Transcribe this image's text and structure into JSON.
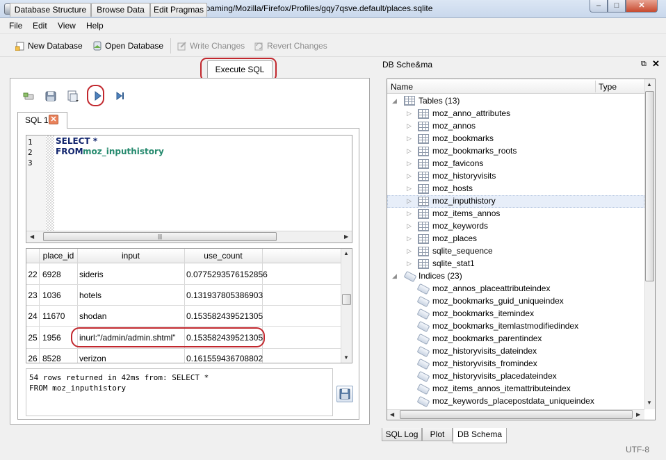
{
  "window": {
    "title": "DB Browser for SQLite - C:/Users/███/AppData/Roaming/Mozilla/Firefox/Profiles/gqy7qsve.default/places.sqlite"
  },
  "menu": [
    "File",
    "Edit",
    "View",
    "Help"
  ],
  "toolbar": {
    "new_db": "New Database",
    "open_db": "Open Database",
    "write_changes": "Write Changes",
    "revert_changes": "Revert Changes"
  },
  "main_tabs": [
    "Database Structure",
    "Browse Data",
    "Edit Pragmas",
    "Execute SQL"
  ],
  "sql_tab": {
    "label": "SQL 1",
    "close": "✕"
  },
  "editor": {
    "line_numbers": [
      "1",
      "2",
      "3"
    ],
    "line1_keyword": "SELECT *",
    "line2_keyword": "FROM",
    "line2_table": "moz_inputhistory"
  },
  "results": {
    "columns": [
      "place_id",
      "input",
      "use_count"
    ],
    "rows": [
      {
        "n": "22",
        "place_id": "6928",
        "input": "sideris",
        "use_count": "0.0775293576152856"
      },
      {
        "n": "23",
        "place_id": "1036",
        "input": "hotels",
        "use_count": "0.131937805386903"
      },
      {
        "n": "24",
        "place_id": "11670",
        "input": "shodan",
        "use_count": "0.153582439521305"
      },
      {
        "n": "25",
        "place_id": "1956",
        "input": "inurl:\"/admin/admin.shtml\"",
        "use_count": "0.153582439521305"
      },
      {
        "n": "26",
        "place_id": "8528",
        "input": "verizon",
        "use_count": "0.161559436708802"
      }
    ]
  },
  "message": {
    "line1": "54 rows returned in 42ms from: SELECT *",
    "line2": "FROM moz_inputhistory"
  },
  "schema": {
    "title": "DB Sche&ma",
    "float_icon": "⧉",
    "close_icon": "✕",
    "col_name": "Name",
    "col_type": "Type",
    "tables_label": "Tables (13)",
    "tables": [
      "moz_anno_attributes",
      "moz_annos",
      "moz_bookmarks",
      "moz_bookmarks_roots",
      "moz_favicons",
      "moz_historyvisits",
      "moz_hosts",
      "moz_inputhistory",
      "moz_items_annos",
      "moz_keywords",
      "moz_places",
      "sqlite_sequence",
      "sqlite_stat1"
    ],
    "indices_label": "Indices (23)",
    "indices": [
      "moz_annos_placeattributeindex",
      "moz_bookmarks_guid_uniqueindex",
      "moz_bookmarks_itemindex",
      "moz_bookmarks_itemlastmodifiedindex",
      "moz_bookmarks_parentindex",
      "moz_historyvisits_dateindex",
      "moz_historyvisits_fromindex",
      "moz_historyvisits_placedateindex",
      "moz_items_annos_itemattributeindex",
      "moz_keywords_placepostdata_uniqueindex"
    ]
  },
  "bottom_tabs": [
    "SQL Log",
    "Plot",
    "DB Schema"
  ],
  "status": {
    "encoding": "UTF-8"
  },
  "colors": {
    "highlight": "#c1272d",
    "keyword": "#10246d",
    "identifier": "#268a6e"
  }
}
